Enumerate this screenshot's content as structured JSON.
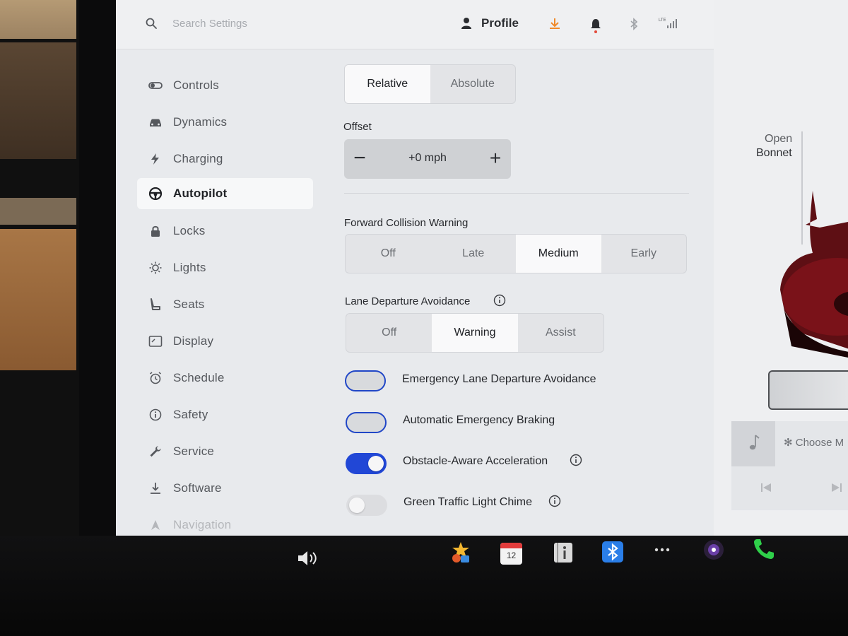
{
  "topbar": {
    "search_placeholder": "Search Settings",
    "profile_label": "Profile",
    "download_color": "#f08a2a",
    "icons": [
      "search-icon",
      "profile-icon",
      "download-icon",
      "bell-icon",
      "bluetooth-icon",
      "signal-icon"
    ]
  },
  "sidebar": {
    "items": [
      {
        "label": "Controls",
        "icon": "toggle-icon"
      },
      {
        "label": "Dynamics",
        "icon": "car-icon"
      },
      {
        "label": "Charging",
        "icon": "bolt-icon"
      },
      {
        "label": "Autopilot",
        "icon": "steering-wheel-icon",
        "active": true
      },
      {
        "label": "Locks",
        "icon": "lock-icon"
      },
      {
        "label": "Lights",
        "icon": "sun-icon"
      },
      {
        "label": "Seats",
        "icon": "seat-icon"
      },
      {
        "label": "Display",
        "icon": "display-icon"
      },
      {
        "label": "Schedule",
        "icon": "alarm-icon"
      },
      {
        "label": "Safety",
        "icon": "info-circle-icon"
      },
      {
        "label": "Service",
        "icon": "wrench-icon"
      },
      {
        "label": "Software",
        "icon": "download-icon"
      },
      {
        "label": "Navigation",
        "icon": "nav-arrow-icon"
      }
    ]
  },
  "speed_limit": {
    "options": [
      "Relative",
      "Absolute"
    ],
    "selected": "Relative"
  },
  "offset": {
    "label": "Offset",
    "value": "+0 mph",
    "minus": "−",
    "plus": "+"
  },
  "fcw": {
    "label": "Forward Collision Warning",
    "options": [
      "Off",
      "Late",
      "Medium",
      "Early"
    ],
    "selected": "Medium"
  },
  "lda": {
    "label": "Lane Departure Avoidance",
    "options": [
      "Off",
      "Warning",
      "Assist"
    ],
    "selected": "Warning"
  },
  "toggles": [
    {
      "label": "Emergency Lane Departure Avoidance",
      "state": "outlined",
      "info": false
    },
    {
      "label": "Automatic Emergency Braking",
      "state": "outlined",
      "info": false
    },
    {
      "label": "Obstacle-Aware Acceleration",
      "state": "on",
      "info": true
    },
    {
      "label": "Green Traffic Light Chime",
      "state": "off",
      "info": true
    }
  ],
  "right_panel": {
    "open_label": "Open",
    "bonnet_label": "Bonnet",
    "media_source": "✻ Choose M"
  },
  "dock": {
    "calendar_day": "12",
    "icons": [
      "volume-icon",
      "toybox-icon",
      "calendar-icon",
      "manual-icon",
      "bluetooth-app-icon",
      "more-icon",
      "camera-icon",
      "phone-icon"
    ]
  },
  "colors": {
    "accent_blue": "#2147d6",
    "phone_green": "#2fd04a"
  }
}
